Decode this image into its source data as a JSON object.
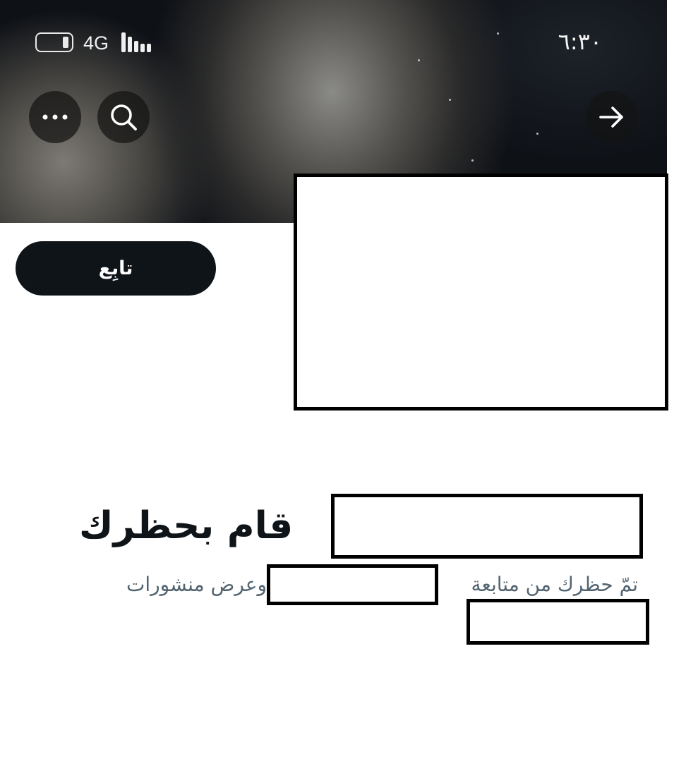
{
  "status_bar": {
    "time": "٦:٣٠",
    "network": "4G",
    "battery_icon": "battery-icon",
    "signal_icon": "signal-bars-icon"
  },
  "header": {
    "banner": "statue-banner-image",
    "icons": {
      "more": "more-horizontal-icon",
      "search": "search-icon",
      "forward": "arrow-right-icon"
    }
  },
  "profile": {
    "follow_label": "تابِع"
  },
  "blocked": {
    "title": "قام بحظرك",
    "description_start": "تمّ حظرك من متابعة",
    "description_middle": "وعرض منشورات"
  },
  "colors": {
    "primary": "#0f1419",
    "secondary_text": "#536471",
    "background": "#ffffff"
  }
}
